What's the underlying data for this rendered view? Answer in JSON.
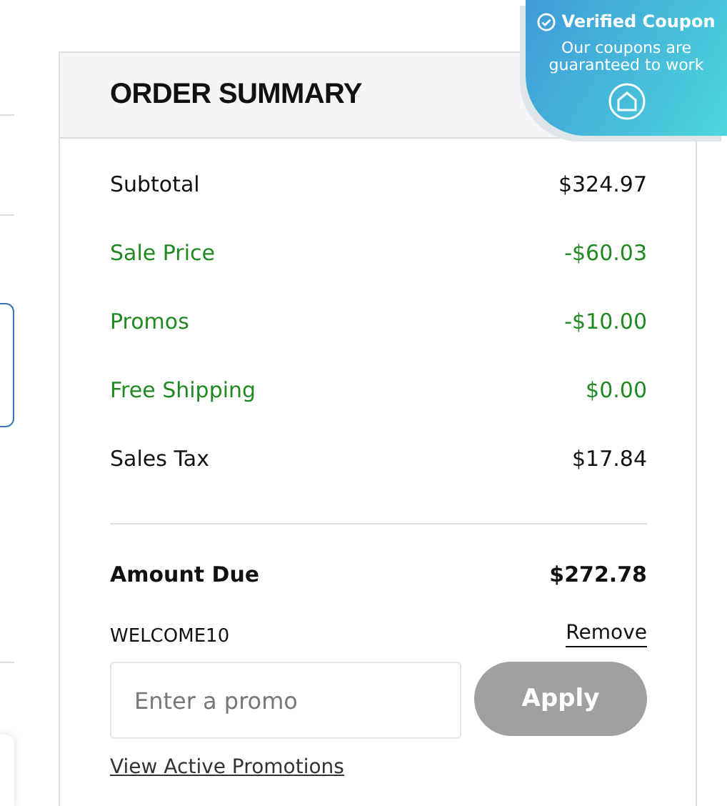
{
  "badge": {
    "title": "Verified Coupon",
    "text": "Our coupons are guaranteed to work"
  },
  "order_summary": {
    "title": "ORDER SUMMARY",
    "lines": [
      {
        "label": "Subtotal",
        "amount": "$324.97",
        "kind": "charge"
      },
      {
        "label": "Sale Price",
        "amount": "-$60.03",
        "kind": "discount"
      },
      {
        "label": "Promos",
        "amount": "-$10.00",
        "kind": "discount"
      },
      {
        "label": "Free Shipping",
        "amount": "$0.00",
        "kind": "discount"
      },
      {
        "label": "Sales Tax",
        "amount": "$17.84",
        "kind": "charge"
      }
    ],
    "total": {
      "label": "Amount Due",
      "amount": "$272.78"
    },
    "applied_code": "WELCOME10",
    "remove_link": "Remove",
    "promo_field": {
      "placeholder": "Enter a promo"
    },
    "apply_button": {
      "label": "Apply",
      "disabled": true
    },
    "promotions_link": "View Active Promotions"
  }
}
